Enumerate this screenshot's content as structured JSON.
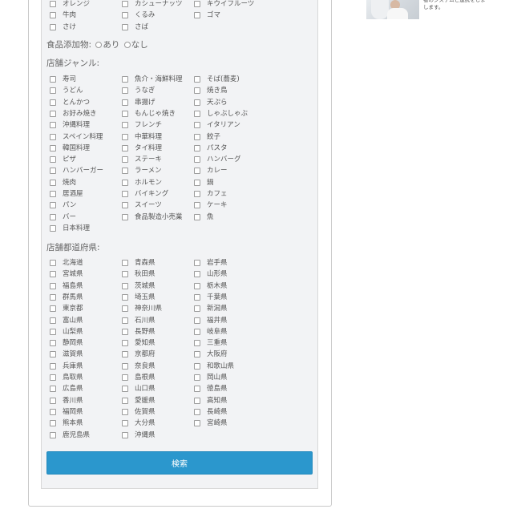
{
  "fruits_partial": {
    "rows": [
      [
        "オレンジ",
        "カシューナッツ",
        "キウイフルーツ"
      ],
      [
        "牛肉",
        "くるみ",
        "ゴマ"
      ],
      [
        "さけ",
        "さば",
        ""
      ]
    ]
  },
  "food_additives": {
    "label": "食品添加物:",
    "option_yes": "あり",
    "option_no": "なし"
  },
  "genre": {
    "label": "店舗ジャンル:",
    "rows": [
      [
        "寿司",
        "魚介・海鮮料理",
        "そば(蕎麦)"
      ],
      [
        "うどん",
        "うなぎ",
        "焼き鳥"
      ],
      [
        "とんかつ",
        "串揚げ",
        "天ぷら"
      ],
      [
        "お好み焼き",
        "もんじゃ焼き",
        "しゃぶしゃぶ"
      ],
      [
        "沖縄料理",
        "フレンチ",
        "イタリアン"
      ],
      [
        "スペイン料理",
        "中華料理",
        "餃子"
      ],
      [
        "韓国料理",
        "タイ料理",
        "パスタ"
      ],
      [
        "ピザ",
        "ステーキ",
        "ハンバーグ"
      ],
      [
        "ハンバーガー",
        "ラーメン",
        "カレー"
      ],
      [
        "焼肉",
        "ホルモン",
        "鍋"
      ],
      [
        "居酒屋",
        "バイキング",
        "カフェ"
      ],
      [
        "パン",
        "スイーツ",
        "ケーキ"
      ],
      [
        "バー",
        "食品製造小売業",
        "魚"
      ],
      [
        "日本料理",
        "",
        ""
      ]
    ]
  },
  "prefecture": {
    "label": "店舗都道府県:",
    "rows": [
      [
        "北海道",
        "青森県",
        "岩手県"
      ],
      [
        "宮城県",
        "秋田県",
        "山形県"
      ],
      [
        "福島県",
        "茨城県",
        "栃木県"
      ],
      [
        "群馬県",
        "埼玉県",
        "千葉県"
      ],
      [
        "東京都",
        "神奈川県",
        "新潟県"
      ],
      [
        "富山県",
        "石川県",
        "福井県"
      ],
      [
        "山梨県",
        "長野県",
        "岐阜県"
      ],
      [
        "静岡県",
        "愛知県",
        "三重県"
      ],
      [
        "滋賀県",
        "京都府",
        "大阪府"
      ],
      [
        "兵庫県",
        "奈良県",
        "和歌山県"
      ],
      [
        "鳥取県",
        "島根県",
        "岡山県"
      ],
      [
        "広島県",
        "山口県",
        "徳島県"
      ],
      [
        "香川県",
        "愛媛県",
        "高知県"
      ],
      [
        "福岡県",
        "佐賀県",
        "長崎県"
      ],
      [
        "熊本県",
        "大分県",
        "宮崎県"
      ],
      [
        "鹿児島県",
        "沖縄県",
        ""
      ]
    ]
  },
  "search_button": "検索",
  "side_text": "者のシステムと連携をしま\nします。",
  "colors": {
    "button": "#2b97cd",
    "panel_bg": "#f2f3f5"
  }
}
